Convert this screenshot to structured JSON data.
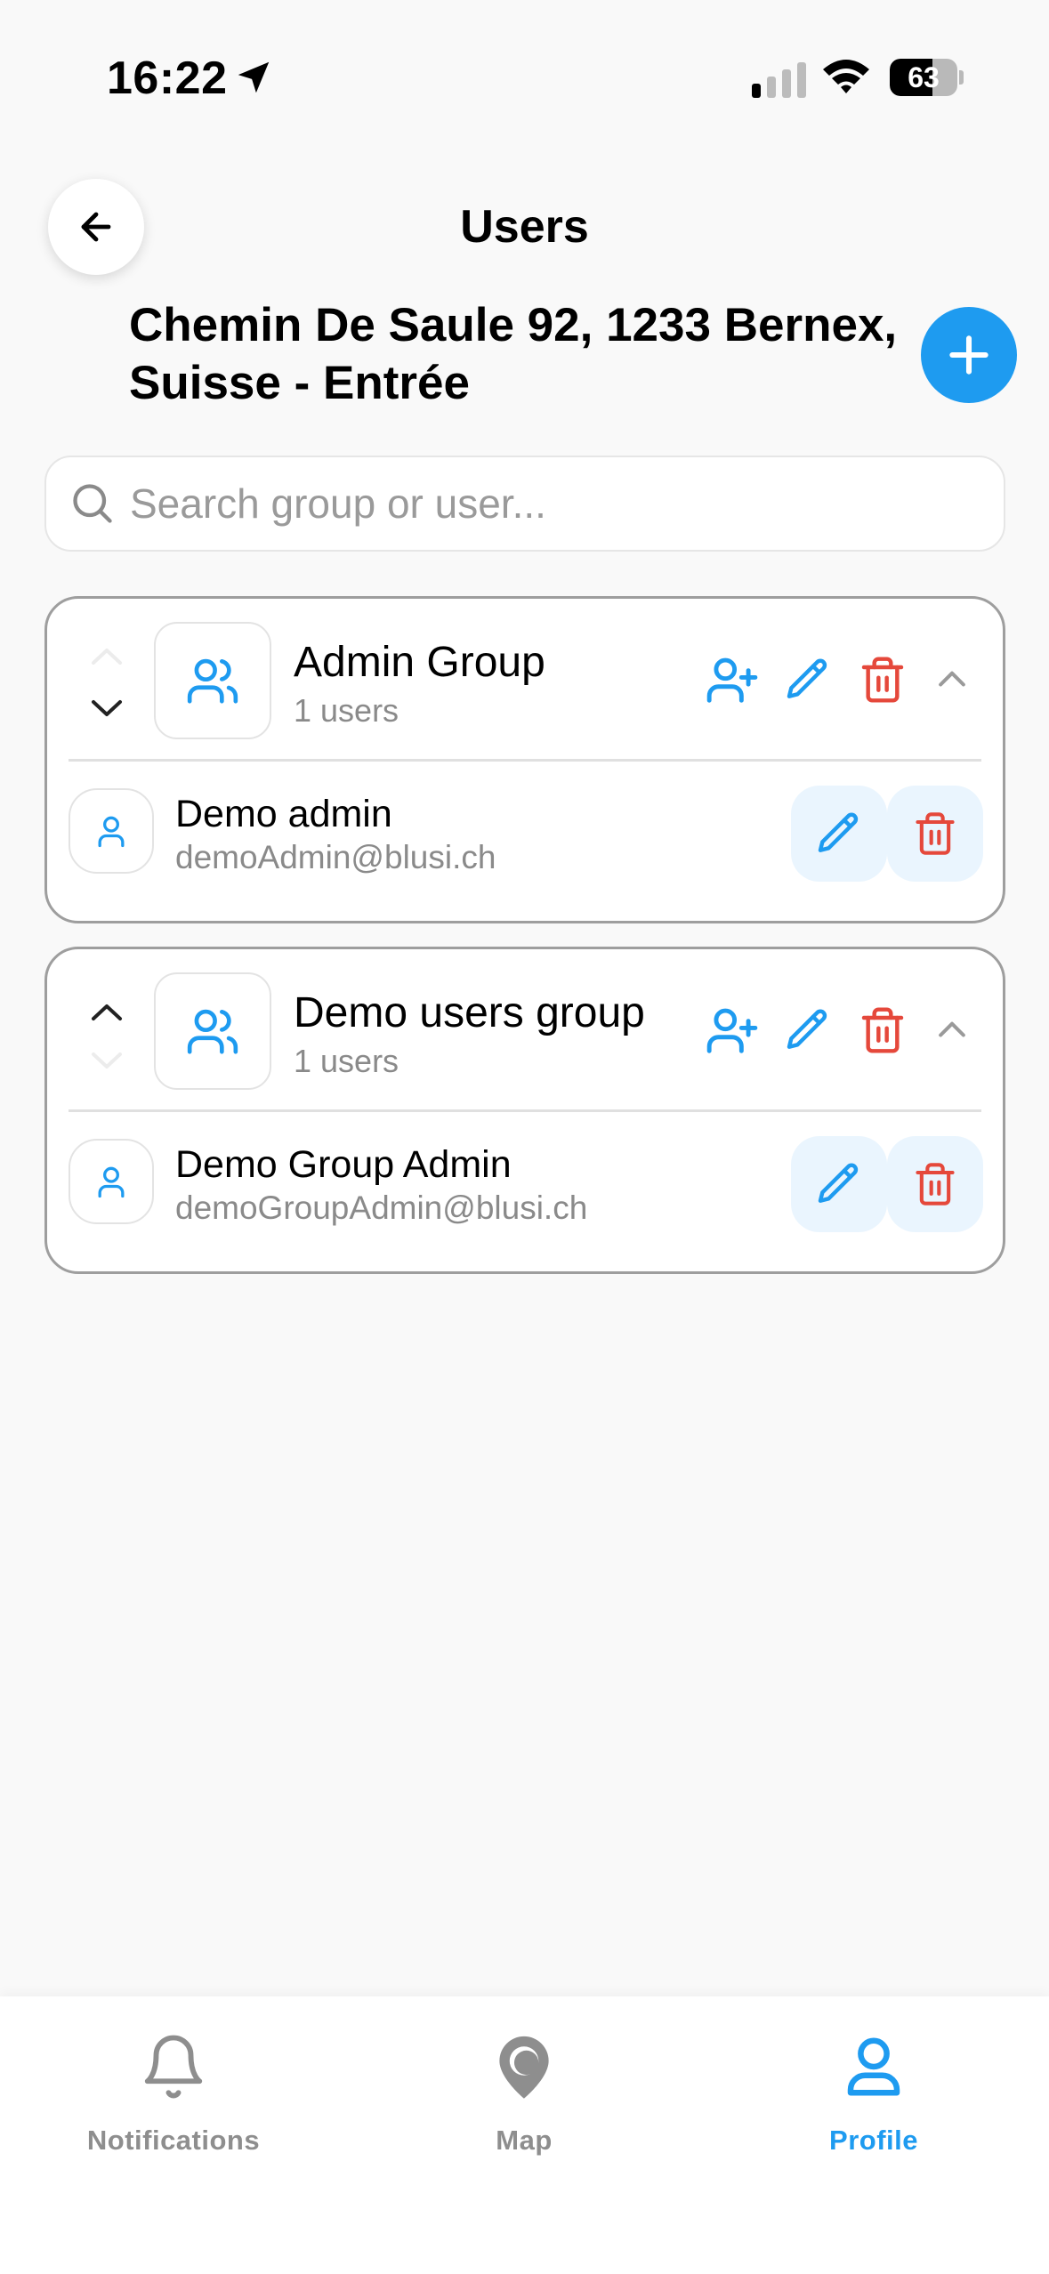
{
  "status_bar": {
    "time": "16:22",
    "battery": "63",
    "battery_level": 0.63
  },
  "header": {
    "title": "Users",
    "address_line1": "Chemin De Saule 92, 1233 Bernex,",
    "address_line2": "Suisse - Entrée"
  },
  "search": {
    "placeholder": "Search group or user..."
  },
  "groups": [
    {
      "name": "Admin Group",
      "count": "1 users",
      "user": {
        "name": "Demo admin",
        "email": "demoAdmin@blusi.ch"
      }
    },
    {
      "name": "Demo users group",
      "count": "1 users",
      "user": {
        "name": "Demo Group Admin",
        "email": "demoGroupAdmin@blusi.ch"
      }
    }
  ],
  "tabs": [
    {
      "label": "Notifications",
      "icon": "bell-icon"
    },
    {
      "label": "Map",
      "icon": "map-pin-icon"
    },
    {
      "label": "Profile",
      "icon": "person-icon",
      "active": true
    }
  ],
  "colors": {
    "accent": "#1e9bf0",
    "danger": "#e5483b",
    "inactive": "#8e8e8e"
  }
}
